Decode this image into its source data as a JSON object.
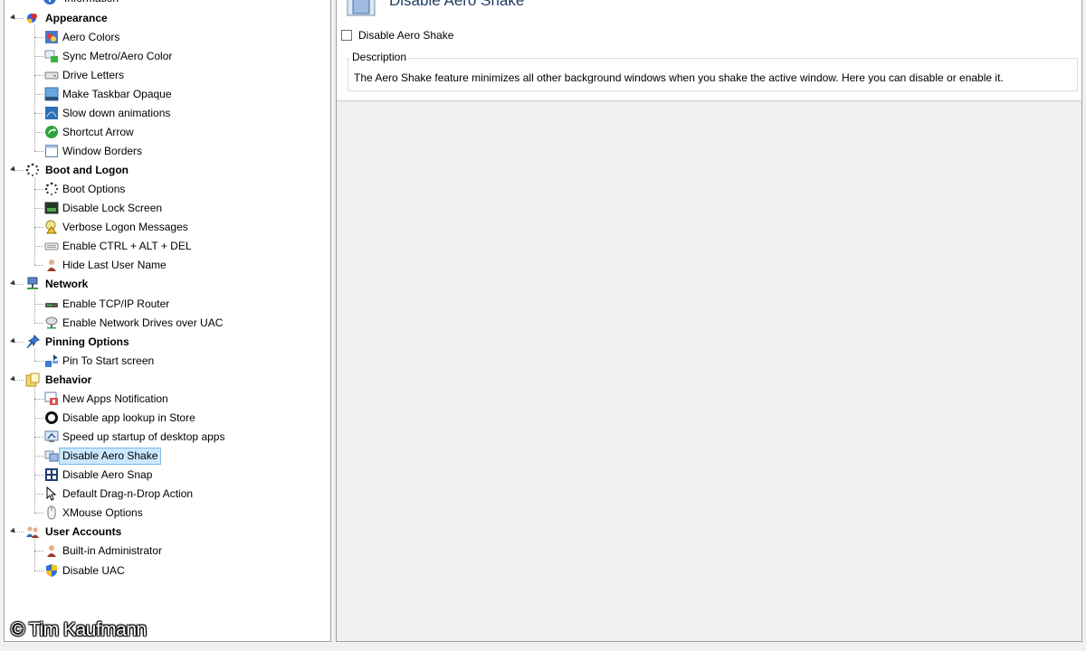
{
  "tree": {
    "partial_top_label": "Information",
    "groups": [
      {
        "label": "Appearance",
        "icon": "appearance-icon",
        "items": [
          {
            "label": "Aero Colors",
            "icon": "aero-colors-icon"
          },
          {
            "label": "Sync Metro/Aero Color",
            "icon": "sync-color-icon"
          },
          {
            "label": "Drive Letters",
            "icon": "drive-icon"
          },
          {
            "label": "Make Taskbar Opaque",
            "icon": "taskbar-icon"
          },
          {
            "label": "Slow down animations",
            "icon": "animation-icon"
          },
          {
            "label": "Shortcut Arrow",
            "icon": "shortcut-arrow-icon"
          },
          {
            "label": "Window Borders",
            "icon": "window-borders-icon"
          }
        ]
      },
      {
        "label": "Boot and Logon",
        "icon": "boot-icon",
        "items": [
          {
            "label": "Boot Options",
            "icon": "boot-options-icon"
          },
          {
            "label": "Disable Lock Screen",
            "icon": "lock-screen-icon"
          },
          {
            "label": "Verbose Logon Messages",
            "icon": "verbose-logon-icon"
          },
          {
            "label": "Enable CTRL + ALT + DEL",
            "icon": "keyboard-icon"
          },
          {
            "label": "Hide Last User Name",
            "icon": "user-icon"
          }
        ]
      },
      {
        "label": "Network",
        "icon": "network-icon",
        "items": [
          {
            "label": "Enable TCP/IP Router",
            "icon": "router-icon"
          },
          {
            "label": "Enable Network Drives over UAC",
            "icon": "network-drive-icon"
          }
        ]
      },
      {
        "label": "Pinning Options",
        "icon": "pin-icon",
        "items": [
          {
            "label": "Pin To Start screen",
            "icon": "pin-start-icon"
          }
        ]
      },
      {
        "label": "Behavior",
        "icon": "behavior-icon",
        "items": [
          {
            "label": "New Apps Notification",
            "icon": "notification-icon"
          },
          {
            "label": "Disable app lookup in Store",
            "icon": "store-icon"
          },
          {
            "label": "Speed up startup of desktop apps",
            "icon": "speedup-icon"
          },
          {
            "label": "Disable Aero Shake",
            "icon": "aero-shake-icon",
            "selected": true
          },
          {
            "label": "Disable Aero Snap",
            "icon": "aero-snap-icon"
          },
          {
            "label": "Default Drag-n-Drop Action",
            "icon": "drag-drop-icon"
          },
          {
            "label": "XMouse Options",
            "icon": "mouse-icon"
          }
        ]
      },
      {
        "label": "User Accounts",
        "icon": "users-icon",
        "items": [
          {
            "label": "Built-in Administrator",
            "icon": "admin-icon"
          },
          {
            "label": "Disable UAC",
            "icon": "uac-shield-icon"
          }
        ]
      }
    ]
  },
  "content": {
    "heading": "Disable Aero Shake",
    "checkbox_label": "Disable Aero Shake",
    "checkbox_checked": false,
    "description_title": "Description",
    "description_text": "The Aero Shake feature minimizes all other background windows when you shake the active window. Here you can disable or enable it."
  },
  "watermark": "© Tim Kaufmann",
  "colors": {
    "selection_bg": "#cce8ff",
    "selection_border": "#7fb8e6",
    "panel_border": "#a0a0a0"
  }
}
